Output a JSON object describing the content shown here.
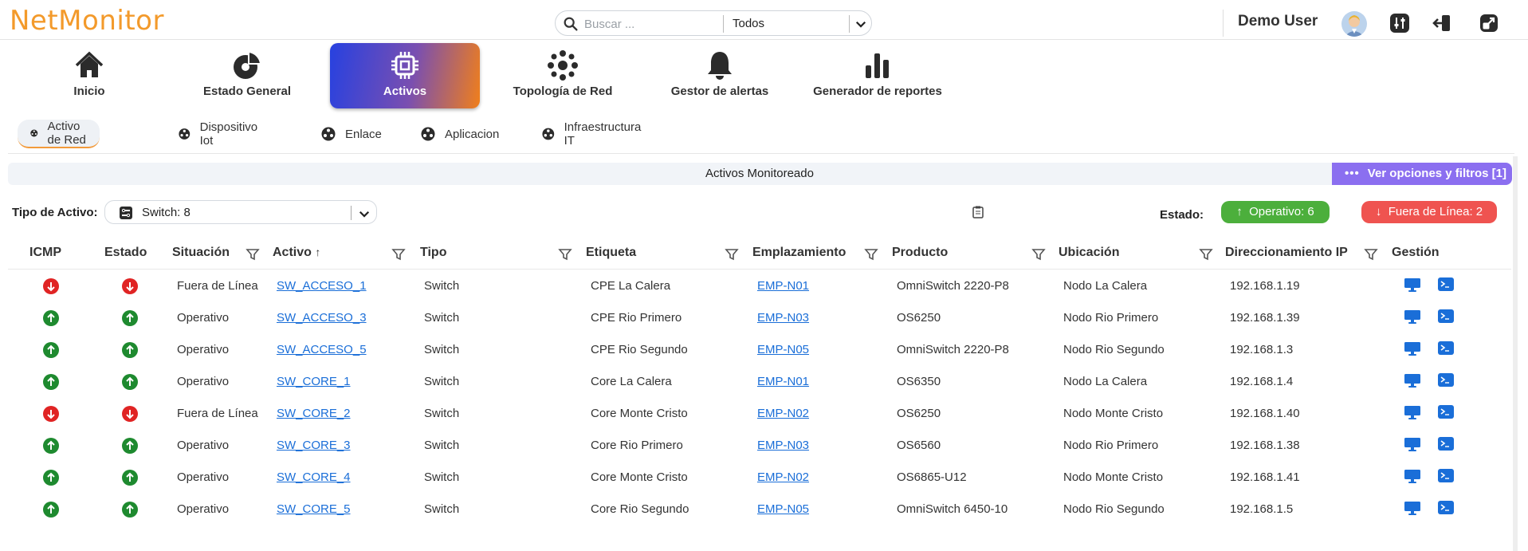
{
  "app": {
    "logo_text": "NetMonitor",
    "brand_color": "#f39a2b"
  },
  "search": {
    "placeholder": "Buscar ...",
    "scope_selected": "Todos"
  },
  "user": {
    "name": "Demo User"
  },
  "nav": {
    "items": [
      {
        "label": "Inicio",
        "icon": "home-icon"
      },
      {
        "label": "Estado General",
        "icon": "status-icon"
      },
      {
        "label": "Activos",
        "icon": "chip-icon",
        "active": true
      },
      {
        "label": "Topología de Red",
        "icon": "topology-icon"
      },
      {
        "label": "Gestor de alertas",
        "icon": "bell-icon"
      },
      {
        "label": "Generador de reportes",
        "icon": "bar-chart-icon"
      }
    ]
  },
  "subtabs": [
    {
      "label": "Activo de Red",
      "active": true
    },
    {
      "label": "Dispositivo Iot"
    },
    {
      "label": "Enlace"
    },
    {
      "label": "Aplicacion"
    },
    {
      "label": "Infraestructura IT"
    }
  ],
  "panel": {
    "title": "Activos Monitoreado",
    "filters_button": "Ver opciones y filtros [1]"
  },
  "filters": {
    "tipo_label": "Tipo de Activo:",
    "tipo_value": "Switch: 8",
    "estado_label": "Estado:",
    "operativo": "Operativo: 6",
    "fuera": "Fuera de Línea: 2",
    "colors": {
      "up": "#1e8a2f",
      "down": "#e02424",
      "op_pill": "#4caf3c",
      "fl_pill": "#ef5350",
      "link": "#1a6ed8",
      "filters_btn": "#8b6ff0"
    }
  },
  "table": {
    "headers": [
      "ICMP",
      "Estado",
      "Situación",
      "Activo",
      "Tipo",
      "Etiqueta",
      "Emplazamiento",
      "Producto",
      "Ubicación",
      "Direccionamiento IP",
      "Gestión"
    ],
    "sort_indicator": "↑",
    "rows": [
      {
        "icmp": "down",
        "estado": "down",
        "situacion": "Fuera de Línea",
        "activo": "SW_ACCESO_1",
        "tipo": "Switch",
        "etiqueta": "CPE La Calera",
        "emplazamiento": "EMP-N01",
        "producto": "OmniSwitch 2220-P8",
        "ubicacion": "Nodo La Calera",
        "ip": "192.168.1.19"
      },
      {
        "icmp": "up",
        "estado": "up",
        "situacion": "Operativo",
        "activo": "SW_ACCESO_3",
        "tipo": "Switch",
        "etiqueta": "CPE Rio Primero",
        "emplazamiento": "EMP-N03",
        "producto": "OS6250",
        "ubicacion": "Nodo Rio Primero",
        "ip": "192.168.1.39"
      },
      {
        "icmp": "up",
        "estado": "up",
        "situacion": "Operativo",
        "activo": "SW_ACCESO_5",
        "tipo": "Switch",
        "etiqueta": "CPE Rio Segundo",
        "emplazamiento": "EMP-N05",
        "producto": "OmniSwitch 2220-P8",
        "ubicacion": "Nodo Rio Segundo",
        "ip": "192.168.1.3"
      },
      {
        "icmp": "up",
        "estado": "up",
        "situacion": "Operativo",
        "activo": "SW_CORE_1",
        "tipo": "Switch",
        "etiqueta": "Core La Calera",
        "emplazamiento": "EMP-N01",
        "producto": "OS6350",
        "ubicacion": "Nodo La Calera",
        "ip": "192.168.1.4"
      },
      {
        "icmp": "down",
        "estado": "down",
        "situacion": "Fuera de Línea",
        "activo": "SW_CORE_2",
        "tipo": "Switch",
        "etiqueta": "Core Monte Cristo",
        "emplazamiento": "EMP-N02",
        "producto": "OS6250",
        "ubicacion": "Nodo Monte Cristo",
        "ip": "192.168.1.40"
      },
      {
        "icmp": "up",
        "estado": "up",
        "situacion": "Operativo",
        "activo": "SW_CORE_3",
        "tipo": "Switch",
        "etiqueta": "Core Rio Primero",
        "emplazamiento": "EMP-N03",
        "producto": "OS6560",
        "ubicacion": "Nodo Rio Primero",
        "ip": "192.168.1.38"
      },
      {
        "icmp": "up",
        "estado": "up",
        "situacion": "Operativo",
        "activo": "SW_CORE_4",
        "tipo": "Switch",
        "etiqueta": "Core Monte Cristo",
        "emplazamiento": "EMP-N02",
        "producto": "OS6865-U12",
        "ubicacion": "Nodo Monte Cristo",
        "ip": "192.168.1.41"
      },
      {
        "icmp": "up",
        "estado": "up",
        "situacion": "Operativo",
        "activo": "SW_CORE_5",
        "tipo": "Switch",
        "etiqueta": "Core Rio Segundo",
        "emplazamiento": "EMP-N05",
        "producto": "OmniSwitch 6450-10",
        "ubicacion": "Nodo Rio Segundo",
        "ip": "192.168.1.5"
      }
    ]
  }
}
